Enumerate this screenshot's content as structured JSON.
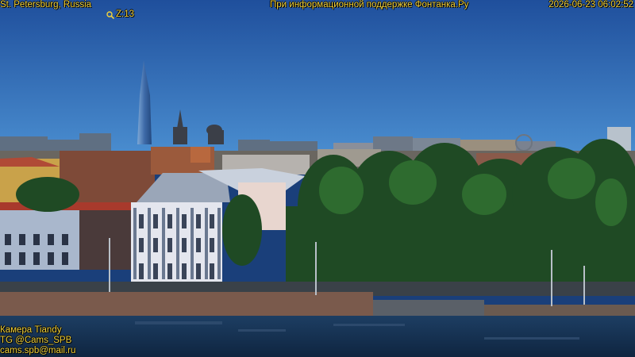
{
  "overlay": {
    "location": "St. Petersburg, Russia",
    "zoom": "Z:13",
    "sponsor": "При информационной поддержке Фонтанка.Ру",
    "timestamp": "2026-06-23 06:02:52",
    "camera": "Камера Tiandy",
    "telegram": "TG @Cams_SPB",
    "email": "cams.spb@mail.ru"
  },
  "colors": {
    "overlay_text": "#f2d23a",
    "sky_top": "#1f4f9c",
    "sky_bottom": "#4b8fd1",
    "water": "#14304f",
    "foliage": "#1f4a24"
  }
}
